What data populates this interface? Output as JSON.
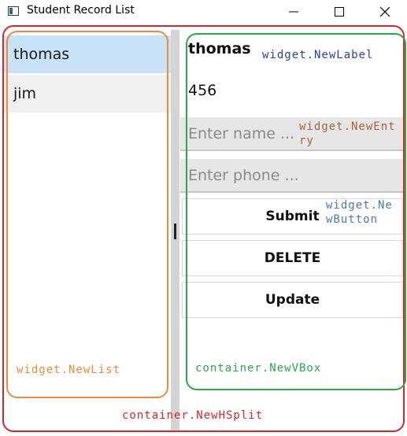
{
  "window": {
    "title": "Student Record List"
  },
  "titlebar": {
    "icons": {
      "app": "app-window-icon",
      "minimize": "minimize-icon",
      "maximize": "maximize-icon",
      "close": "close-icon"
    }
  },
  "list": {
    "items": [
      {
        "label": "thomas",
        "selected": true
      },
      {
        "label": "jim",
        "selected": false
      }
    ]
  },
  "form": {
    "name_label": "thomas",
    "phone_label": "456",
    "name_entry": {
      "value": "",
      "placeholder": "Enter name ..."
    },
    "phone_entry": {
      "value": "",
      "placeholder": "Enter phone ..."
    },
    "submit_label": "Submit",
    "delete_label": "DELETE",
    "update_label": "Update"
  },
  "annotations": {
    "label_widget": "widget.NewLabel",
    "entry_widget_line1": "widget.NewEnt",
    "entry_widget_line2": "ry",
    "button_widget_line1": "widget.Ne",
    "button_widget_line2": "wButton",
    "list_widget": "widget.NewList",
    "vbox_container": "container.NewVBox",
    "hsplit_container": "container.NewHSplit"
  },
  "colors": {
    "selected_row": "#c8e2f8",
    "row_background": "#f0f0f0",
    "entry_background": "#e6e6e6",
    "split_bar": "#d4d4d4",
    "annotation_red": "#d9262e",
    "annotation_orange": "#ee8a3a",
    "annotation_green": "#2aa84a",
    "annotation_blue": "#2a3fa8"
  }
}
